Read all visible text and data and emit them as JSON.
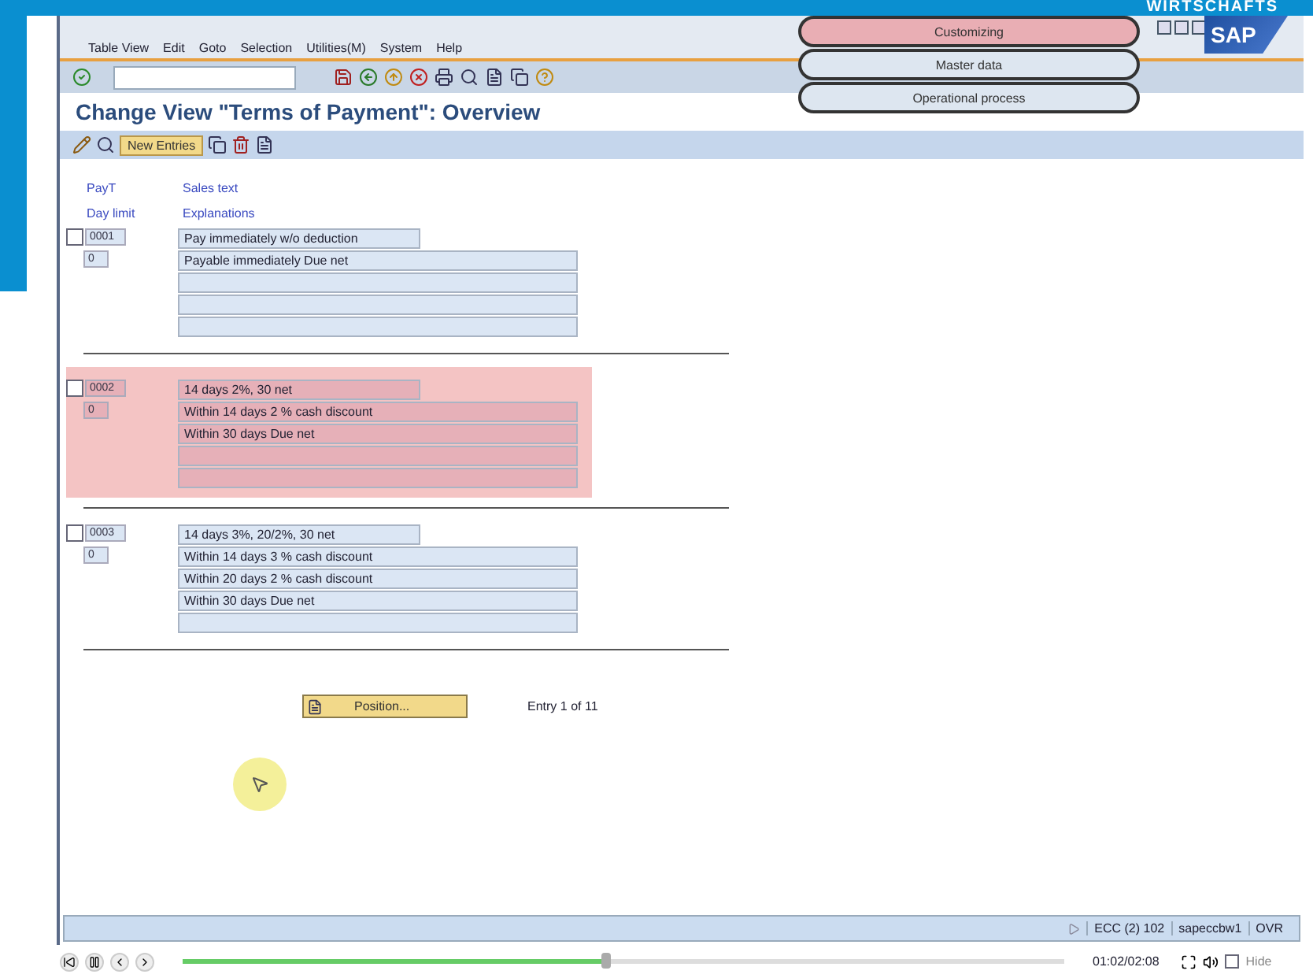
{
  "frame_logo": "WIRTSCHAFTS",
  "menu": [
    "Table View",
    "Edit",
    "Goto",
    "Selection",
    "Utilities(M)",
    "System",
    "Help"
  ],
  "overlay_buttons": [
    {
      "label": "Customizing",
      "selected": true
    },
    {
      "label": "Master data",
      "selected": false
    },
    {
      "label": "Operational process",
      "selected": false
    }
  ],
  "logo_text": "SAP",
  "title": "Change View \"Terms of Payment\": Overview",
  "app_toolbar": {
    "new_entries": "New Entries"
  },
  "columns": {
    "payt": "PayT",
    "day_limit": "Day limit",
    "sales_text": "Sales text",
    "explanations": "Explanations"
  },
  "entries": [
    {
      "payt": "0001",
      "day_limit": "0",
      "checked": false,
      "highlighted": false,
      "sales_text": "Pay immediately w/o deduction",
      "explanations": [
        "Payable immediately Due net"
      ]
    },
    {
      "payt": "0002",
      "day_limit": "0",
      "checked": false,
      "highlighted": true,
      "sales_text": "14 days 2%, 30 net",
      "explanations": [
        "Within 14 days 2 % cash discount",
        "Within 30 days Due net"
      ]
    },
    {
      "payt": "0003",
      "day_limit": "0",
      "checked": false,
      "highlighted": false,
      "sales_text": "14 days 3%, 20/2%, 30 net",
      "explanations": [
        "Within 14 days 3 % cash discount",
        "Within 20 days 2 % cash discount",
        "Within 30 days Due net"
      ]
    }
  ],
  "position_button": "Position...",
  "entry_count": "Entry 1 of 11",
  "status_bar": {
    "system": "ECC (2) 102",
    "server": "sapeccbw1",
    "mode": "OVR"
  },
  "player": {
    "level": 0.48,
    "time": "01:02/02:08",
    "hide_label": "Hide",
    "hide_checked": false
  }
}
